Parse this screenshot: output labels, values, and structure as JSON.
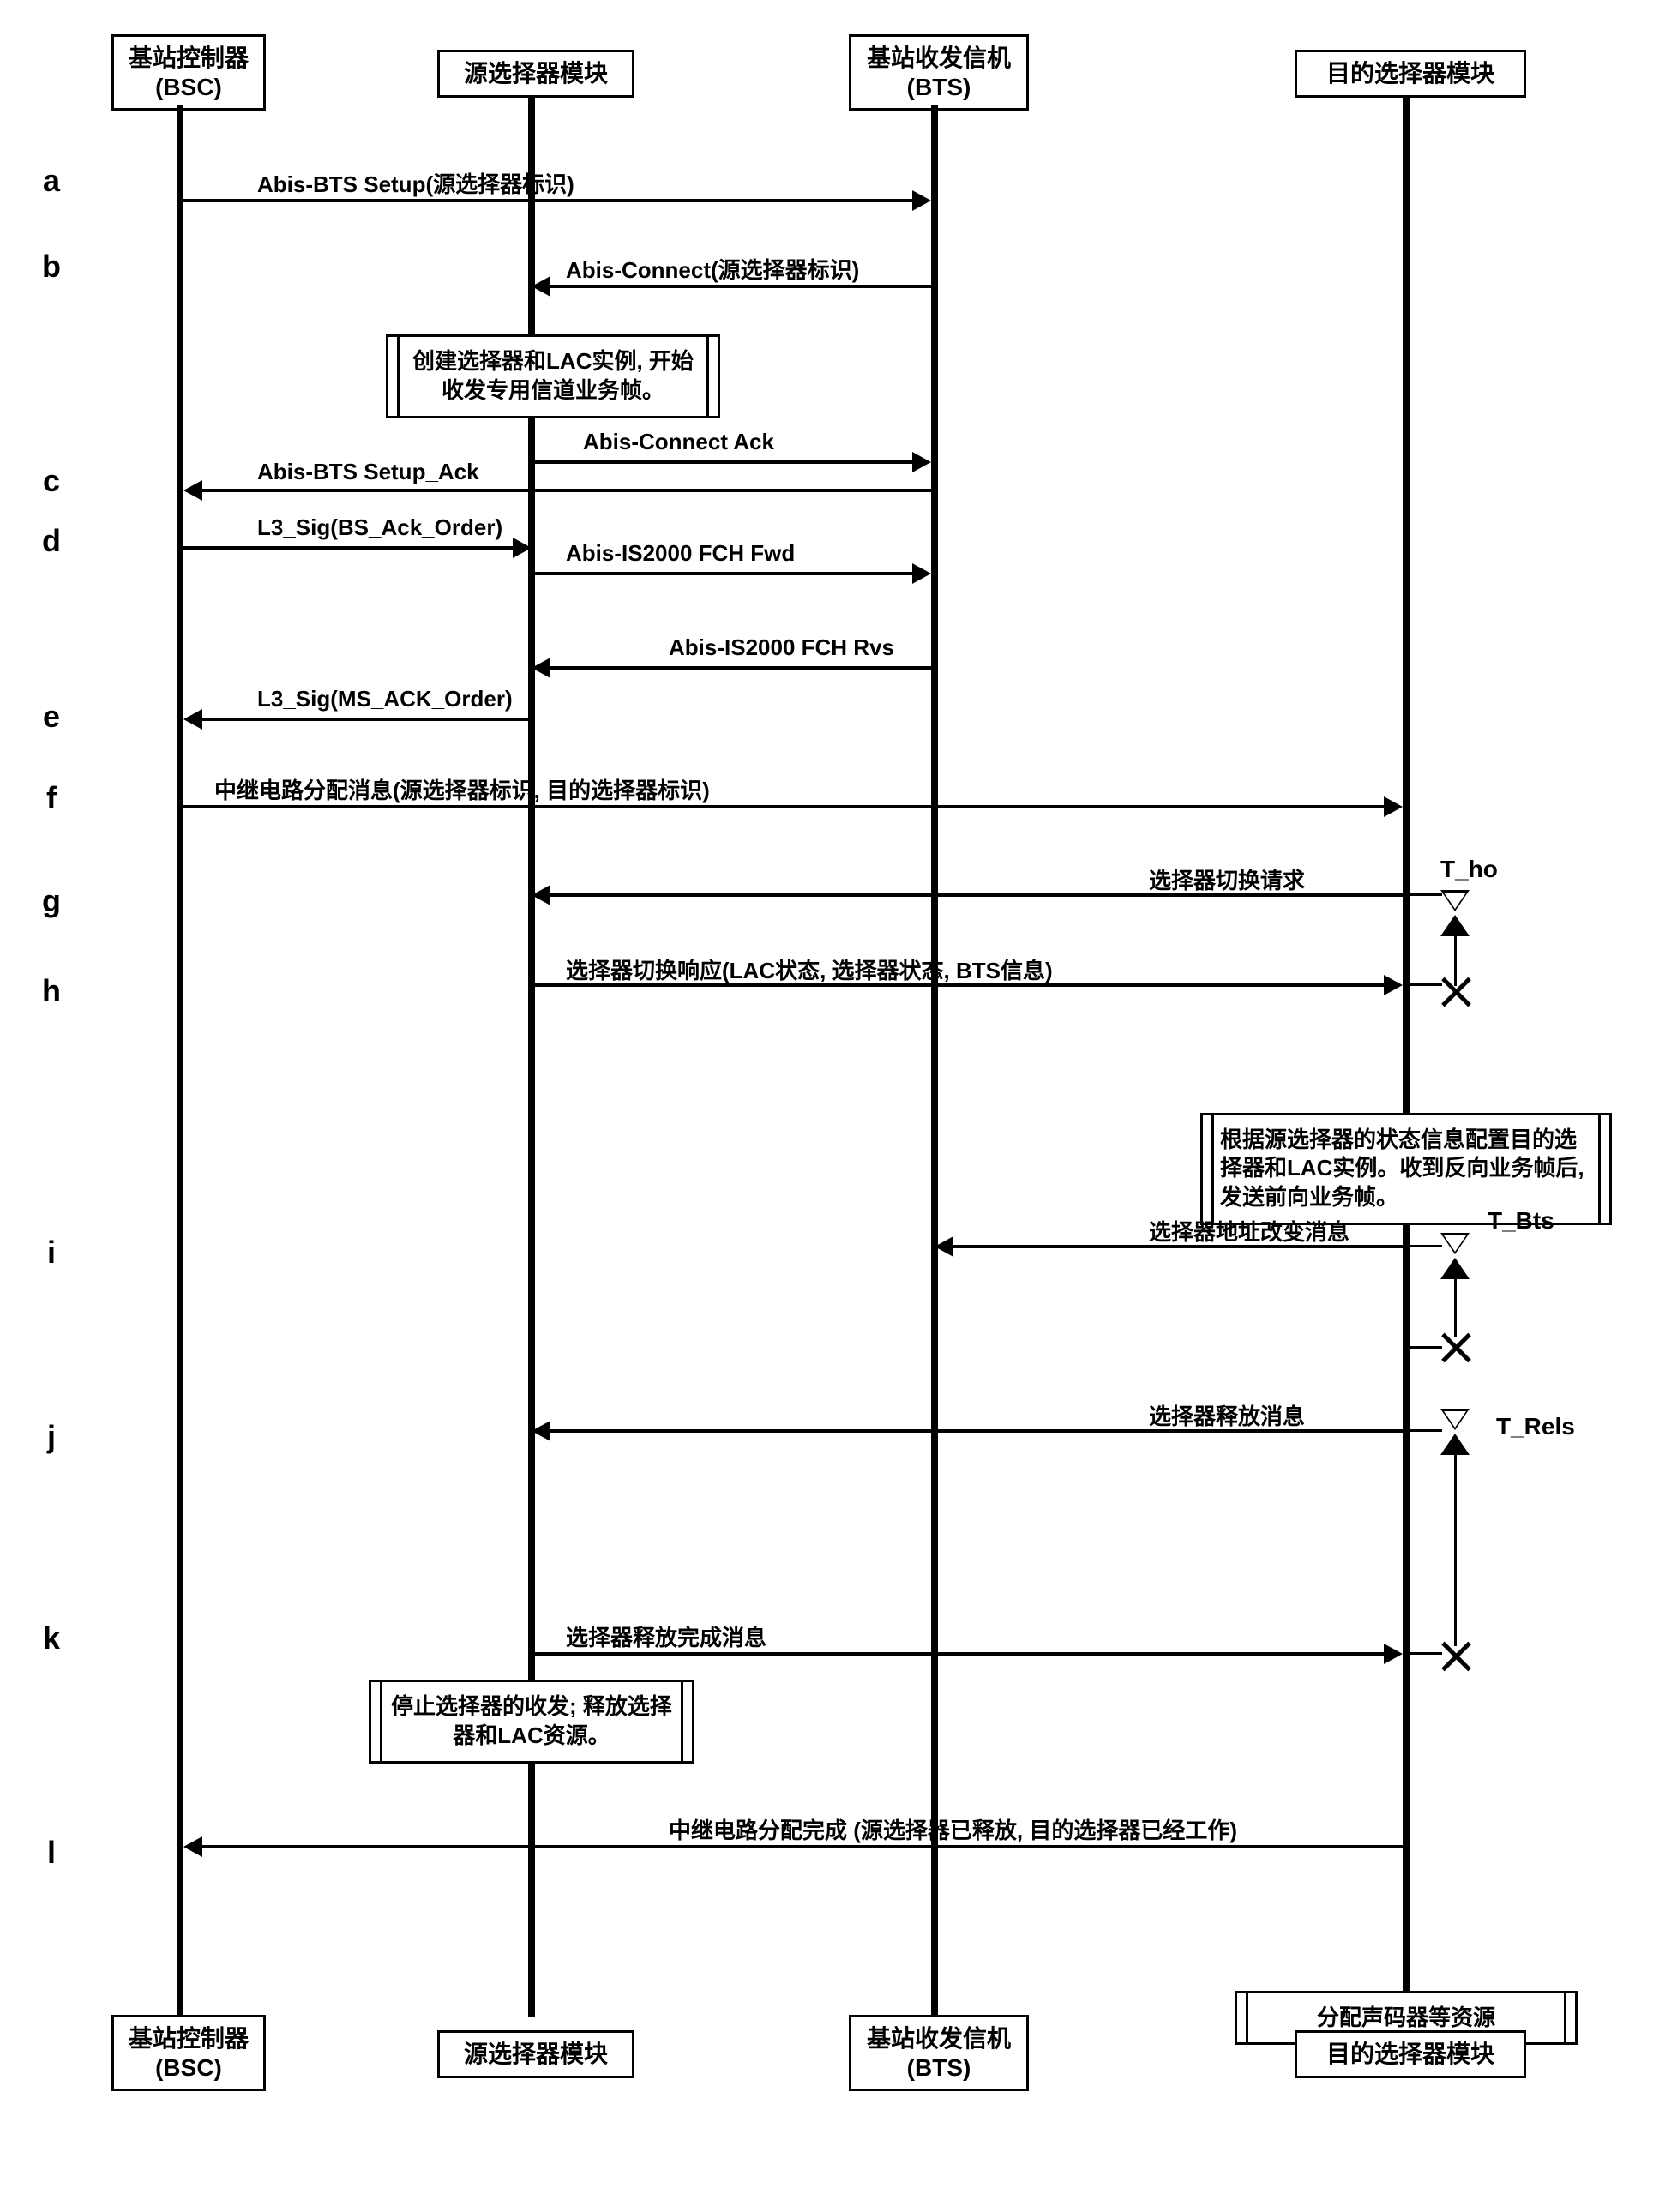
{
  "participants": {
    "bsc": {
      "line1": "基站控制器",
      "line2": "(BSC)"
    },
    "src": {
      "line1": "源选择器模块"
    },
    "bts": {
      "line1": "基站收发信机",
      "line2": "(BTS)"
    },
    "dst": {
      "line1": "目的选择器模块"
    }
  },
  "steps": {
    "a": "a",
    "b": "b",
    "c": "c",
    "d": "d",
    "e": "e",
    "f": "f",
    "g": "g",
    "h": "h",
    "i": "i",
    "j": "j",
    "k": "k",
    "l": "l"
  },
  "messages": {
    "a": "Abis-BTS Setup(源选择器标识)",
    "b": "Abis-Connect(源选择器标识)",
    "c1": "Abis-Connect Ack",
    "c2": "Abis-BTS Setup_Ack",
    "d1": "L3_Sig(BS_Ack_Order)",
    "d2": "Abis-IS2000 FCH Fwd",
    "d3": "Abis-IS2000 FCH Rvs",
    "e": "L3_Sig(MS_ACK_Order)",
    "f": "中继电路分配消息(源选择器标识, 目的选择器标识)",
    "g": "选择器切换请求",
    "h": "选择器切换响应(LAC状态, 选择器状态, BTS信息)",
    "i": "选择器地址改变消息",
    "j": "选择器释放消息",
    "k": "选择器释放完成消息",
    "l": "中继电路分配完成 (源选择器已释放, 目的选择器已经工作)"
  },
  "notes": {
    "n1": "创建选择器和LAC实例, 开始收发专用信道业务帧。",
    "n2": "根据源选择器的状态信息配置目的选择器和LAC实例。收到反向业务帧后, 发送前向业务帧。",
    "n3": "停止选择器的收发; 释放选择器和LAC资源。",
    "n4": "分配声码器等资源"
  },
  "timers": {
    "t_ho": "T_ho",
    "t_bts": "T_Bts",
    "t_rels": "T_Rels"
  },
  "chart_data": {
    "type": "sequence",
    "participants": [
      "基站控制器 (BSC)",
      "源选择器模块",
      "基站收发信机 (BTS)",
      "目的选择器模块"
    ],
    "interactions": [
      {
        "step": "a",
        "from": "BSC",
        "to": "BTS",
        "label": "Abis-BTS Setup(源选择器标识)"
      },
      {
        "step": "b",
        "from": "BTS",
        "to": "源选择器模块",
        "label": "Abis-Connect(源选择器标识)"
      },
      {
        "note": "源选择器模块",
        "text": "创建选择器和LAC实例, 开始收发专用信道业务帧。"
      },
      {
        "step": "c",
        "from": "源选择器模块",
        "to": "BTS",
        "label": "Abis-Connect Ack"
      },
      {
        "step": "c",
        "from": "BTS",
        "to": "BSC",
        "label": "Abis-BTS Setup_Ack"
      },
      {
        "step": "d",
        "from": "BSC",
        "to": "源选择器模块",
        "label": "L3_Sig(BS_Ack_Order)"
      },
      {
        "step": "d",
        "from": "源选择器模块",
        "to": "BTS",
        "label": "Abis-IS2000 FCH Fwd"
      },
      {
        "from": "BTS",
        "to": "源选择器模块",
        "label": "Abis-IS2000 FCH Rvs"
      },
      {
        "step": "e",
        "from": "源选择器模块",
        "to": "BSC",
        "label": "L3_Sig(MS_ACK_Order)"
      },
      {
        "step": "f",
        "from": "BSC",
        "to": "目的选择器模块",
        "label": "中继电路分配消息(源选择器标识, 目的选择器标识)"
      },
      {
        "step": "g",
        "from": "目的选择器模块",
        "to": "源选择器模块",
        "label": "选择器切换请求",
        "timer_start": "T_ho"
      },
      {
        "step": "h",
        "from": "源选择器模块",
        "to": "目的选择器模块",
        "label": "选择器切换响应(LAC状态, 选择器状态, BTS信息)",
        "timer_stop": "T_ho"
      },
      {
        "note": "目的选择器模块",
        "text": "根据源选择器的状态信息配置目的选择器和LAC实例。收到反向业务帧后, 发送前向业务帧。"
      },
      {
        "step": "i",
        "from": "目的选择器模块",
        "to": "BTS",
        "label": "选择器地址改变消息",
        "timer_start": "T_Bts"
      },
      {
        "timer_stop": "T_Bts"
      },
      {
        "step": "j",
        "from": "目的选择器模块",
        "to": "源选择器模块",
        "label": "选择器释放消息",
        "timer_start": "T_Rels"
      },
      {
        "note": "源选择器模块",
        "text": "停止选择器的收发; 释放选择器和LAC资源。"
      },
      {
        "step": "k",
        "from": "源选择器模块",
        "to": "目的选择器模块",
        "label": "选择器释放完成消息",
        "timer_stop": "T_Rels"
      },
      {
        "note": "目的选择器模块",
        "text": "分配声码器等资源"
      },
      {
        "step": "l",
        "from": "目的选择器模块",
        "to": "BSC",
        "label": "中继电路分配完成 (源选择器已释放, 目的选择器已经工作)"
      }
    ]
  }
}
